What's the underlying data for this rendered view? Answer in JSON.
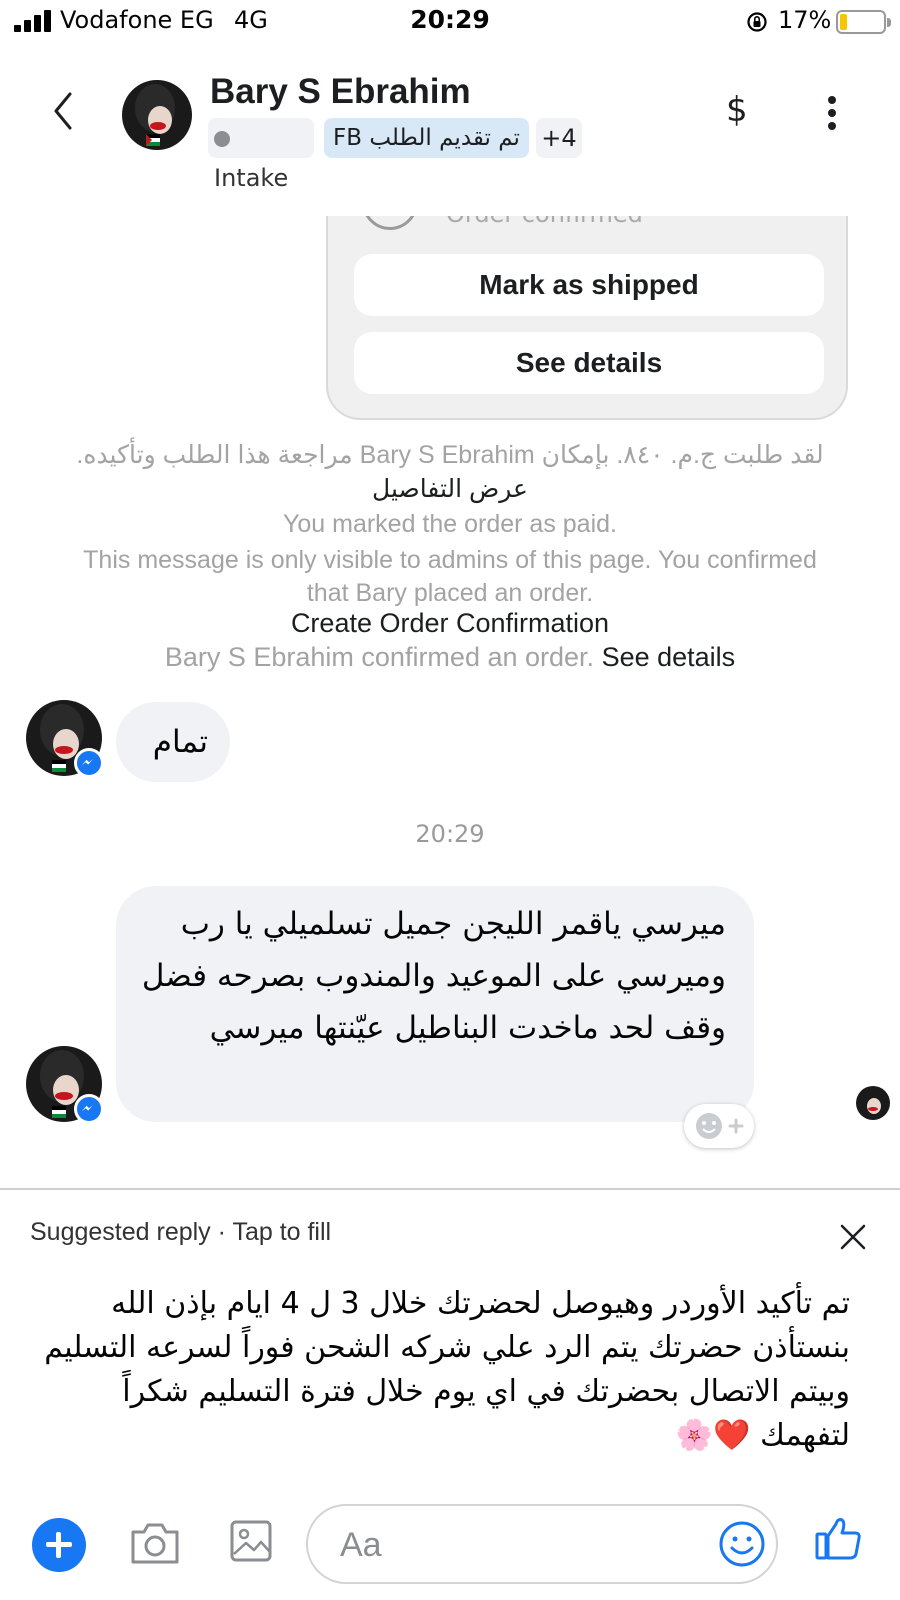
{
  "status_bar": {
    "carrier": "Vodafone EG",
    "network": "4G",
    "time": "20:29",
    "battery": "17%",
    "battery_level": 0.17
  },
  "header": {
    "contact_name": "Bary S Ebrahim",
    "tags": {
      "intake": "Intake",
      "fb_label": "FB تم تقديم الطلب",
      "more": "+4"
    },
    "payment_icon": "$"
  },
  "order_card": {
    "status_text_clipped": "Order confirmed",
    "mark_shipped_label": "Mark as shipped",
    "see_details_label": "See details"
  },
  "system_messages": {
    "order_request": "لقد طلبت ج.م. ٨٤٠. بإمكان Bary S Ebrahim مراجعة هذا الطلب وتأكيده.",
    "view_details_ar": "عرض التفاصيل",
    "marked_paid": "You marked the order as paid.",
    "admin_notice": "This message is only visible to admins of this page. You confirmed that Bary placed an order.",
    "create_confirmation": "Create Order Confirmation",
    "confirmed_order": "Bary S Ebrahim confirmed an order.",
    "see_details_link": "See details"
  },
  "messages": [
    {
      "text": "تمام"
    },
    {
      "text": "ميرسي ياقمر الليجن جميل تسلميلي يا رب وميرسي على الموعيد والمندوب بصرحه فضل وقف لحد ماخدت البناطيل عيّنتها ميرسي"
    }
  ],
  "timestamp": "20:29",
  "suggested_reply": {
    "title": "Suggested reply · Tap to fill",
    "text": "تم تأكيد الأوردر وهيوصل لحضرتك خلال 3 ل 4 ايام بإذن الله بنستأذن حضرتك يتم الرد علي شركه الشحن فوراً لسرعه التسليم وبيتم الاتصال بحضرتك في اي يوم خلال فترة التسليم شكراً لتفهمك ❤️🌸"
  },
  "composer": {
    "placeholder": "Aa"
  },
  "colors": {
    "accent": "#1877f2",
    "bubble": "#f0f2f5",
    "tag_fb": "#d9e8f6"
  }
}
